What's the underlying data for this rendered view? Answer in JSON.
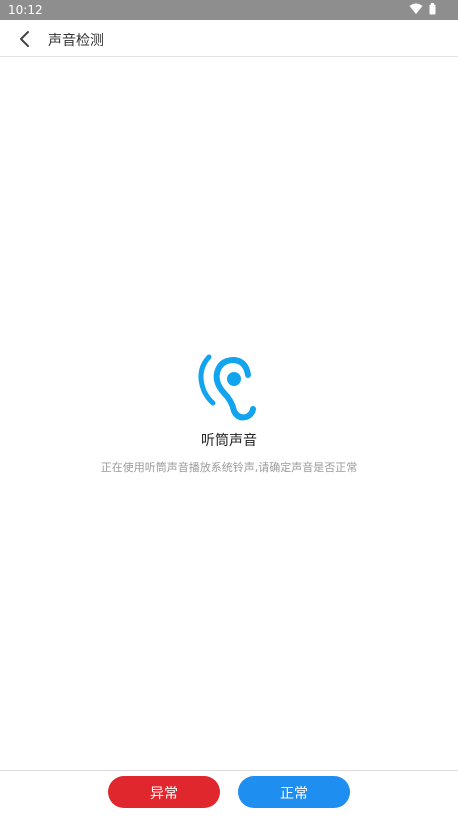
{
  "status_bar": {
    "time": "10:12",
    "icons": [
      "wifi-icon",
      "battery-icon"
    ]
  },
  "header": {
    "back_icon": "chevron-left-icon",
    "title": "声音检测"
  },
  "content": {
    "icon": "ear-icon",
    "title": "听筒声音",
    "description": "正在使用听筒声音播放系统铃声,请确定声音是否正常"
  },
  "footer": {
    "abnormal_label": "异常",
    "normal_label": "正常"
  },
  "colors": {
    "accent_blue": "#1f8ef1",
    "icon_blue": "#12a4ee",
    "danger_red": "#e0272d",
    "status_bar": "#8e8e8e"
  }
}
